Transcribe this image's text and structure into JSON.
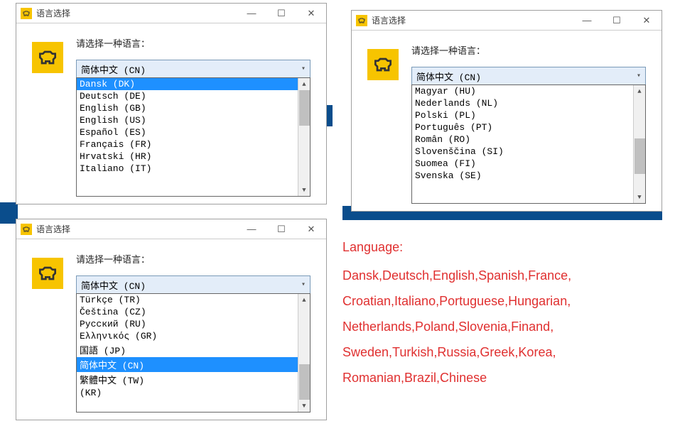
{
  "window1": {
    "title": "语言选择",
    "prompt": "请选择一种语言：",
    "selected": "简体中文 (CN)",
    "items": [
      {
        "label": "Dansk (DK)",
        "selected": true
      },
      {
        "label": "Deutsch (DE)",
        "selected": false
      },
      {
        "label": "English (GB)",
        "selected": false
      },
      {
        "label": "English (US)",
        "selected": false
      },
      {
        "label": "Español (ES)",
        "selected": false
      },
      {
        "label": "Français (FR)",
        "selected": false
      },
      {
        "label": "Hrvatski (HR)",
        "selected": false
      },
      {
        "label": "Italiano (IT)",
        "selected": false
      }
    ]
  },
  "window2": {
    "title": "语言选择",
    "prompt": "请选择一种语言：",
    "selected": "简体中文 (CN)",
    "items": [
      {
        "label": "Magyar (HU)",
        "selected": false
      },
      {
        "label": "Nederlands (NL)",
        "selected": false
      },
      {
        "label": "Polski (PL)",
        "selected": false
      },
      {
        "label": "Português (PT)",
        "selected": false
      },
      {
        "label": "Român (RO)",
        "selected": false
      },
      {
        "label": "Slovenščina (SI)",
        "selected": false
      },
      {
        "label": "Suomea (FI)",
        "selected": false
      },
      {
        "label": "Svenska (SE)",
        "selected": false
      }
    ]
  },
  "window3": {
    "title": "语言选择",
    "prompt": "请选择一种语言：",
    "selected": "简体中文 (CN)",
    "items": [
      {
        "label": "Türkçe (TR)",
        "selected": false
      },
      {
        "label": "Čeština (CZ)",
        "selected": false
      },
      {
        "label": "Русский (RU)",
        "selected": false
      },
      {
        "label": "Eλληνικός (GR)",
        "selected": false
      },
      {
        "label": "国語 (JP)",
        "selected": false
      },
      {
        "label": "简体中文 (CN)",
        "selected": true
      },
      {
        "label": "繁體中文 (TW)",
        "selected": false
      },
      {
        "label": "       (KR)",
        "selected": false
      }
    ]
  },
  "langtext": {
    "header": "Language:",
    "line1": "Dansk,Deutsch,English,Spanish,France,",
    "line2": "Croatian,Italiano,Portuguese,Hungarian,",
    "line3": "Netherlands,Poland,Slovenia,Finand,",
    "line4": "Sweden,Turkish,Russia,Greek,Korea,",
    "line5": "Romanian,Brazil,Chinese"
  },
  "winctrl": {
    "min": "—",
    "max": "☐",
    "close": "✕"
  }
}
